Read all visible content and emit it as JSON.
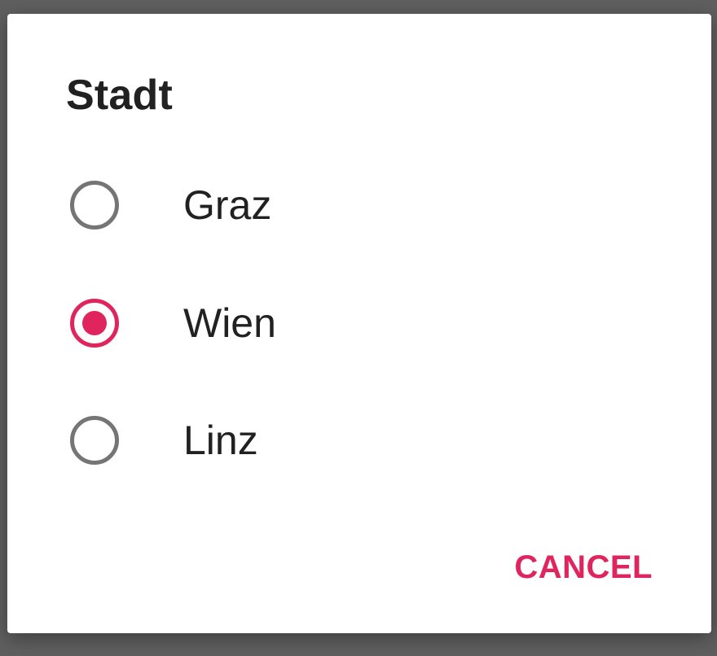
{
  "dialog": {
    "title": "Stadt",
    "options": [
      {
        "label": "Graz",
        "selected": false
      },
      {
        "label": "Wien",
        "selected": true
      },
      {
        "label": "Linz",
        "selected": false
      }
    ],
    "cancel_label": "CANCEL"
  },
  "colors": {
    "accent": "#e0245e",
    "radio_unchecked": "#757575",
    "text": "#212121",
    "scrim": "#5f5f5f",
    "surface": "#ffffff"
  }
}
